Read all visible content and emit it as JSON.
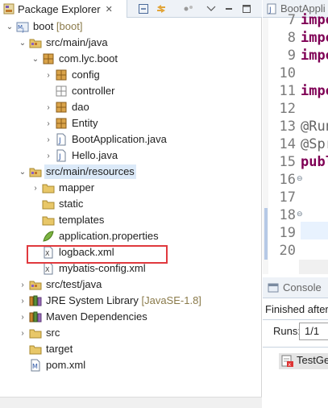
{
  "package_explorer": {
    "tab_title": "Package Explorer",
    "tab_close": "✕",
    "tree": [
      {
        "key": "boot",
        "label": "boot",
        "decoration": "[boot]",
        "icon": "maven-project-icon",
        "twisty": "open"
      },
      {
        "key": "src_main_java",
        "label": "src/main/java",
        "icon": "source-folder-icon",
        "twisty": "open"
      },
      {
        "key": "com_lyc_boot",
        "label": "com.lyc.boot",
        "icon": "package-icon",
        "twisty": "open"
      },
      {
        "key": "config",
        "label": "config",
        "icon": "package-icon",
        "twisty": "closed"
      },
      {
        "key": "controller",
        "label": "controller",
        "icon": "empty-package-icon",
        "twisty": "none"
      },
      {
        "key": "dao",
        "label": "dao",
        "icon": "package-icon",
        "twisty": "closed"
      },
      {
        "key": "entity",
        "label": "Entity",
        "icon": "package-icon",
        "twisty": "closed"
      },
      {
        "key": "bootapp",
        "label": "BootApplication.java",
        "icon": "java-file-icon",
        "twisty": "closed"
      },
      {
        "key": "hello",
        "label": "Hello.java",
        "icon": "java-file-icon",
        "twisty": "closed"
      },
      {
        "key": "src_main_resources",
        "label": "src/main/resources",
        "icon": "source-folder-icon",
        "twisty": "open",
        "selected": true
      },
      {
        "key": "mapper",
        "label": "mapper",
        "icon": "folder-icon",
        "twisty": "closed"
      },
      {
        "key": "static",
        "label": "static",
        "icon": "folder-icon",
        "twisty": "none"
      },
      {
        "key": "templates",
        "label": "templates",
        "icon": "folder-icon",
        "twisty": "none"
      },
      {
        "key": "app_props",
        "label": "application.properties",
        "icon": "properties-file-icon",
        "twisty": "none"
      },
      {
        "key": "logback",
        "label": "logback.xml",
        "icon": "xml-file-icon",
        "twisty": "none",
        "highlighted": true
      },
      {
        "key": "mybatis",
        "label": "mybatis-config.xml",
        "icon": "xml-file-icon",
        "twisty": "none"
      },
      {
        "key": "src_test_java",
        "label": "src/test/java",
        "icon": "source-folder-icon",
        "twisty": "closed"
      },
      {
        "key": "jre",
        "label": "JRE System Library",
        "decoration": "[JavaSE-1.8]",
        "icon": "library-icon",
        "twisty": "closed"
      },
      {
        "key": "maven_deps",
        "label": "Maven Dependencies",
        "icon": "library-icon",
        "twisty": "closed"
      },
      {
        "key": "src",
        "label": "src",
        "icon": "folder-icon",
        "twisty": "closed"
      },
      {
        "key": "target",
        "label": "target",
        "icon": "folder-icon",
        "twisty": "none"
      },
      {
        "key": "pom",
        "label": "pom.xml",
        "icon": "maven-pom-icon",
        "twisty": "none"
      }
    ]
  },
  "editor": {
    "tab_title": "BootAppli",
    "lines": [
      {
        "num": "7",
        "text": "impo",
        "style": "kw"
      },
      {
        "num": "8",
        "text": "impo",
        "style": "kw"
      },
      {
        "num": "9",
        "text": "impo",
        "style": "kw"
      },
      {
        "num": "10",
        "text": "",
        "style": ""
      },
      {
        "num": "11",
        "text": "impo",
        "style": "kw"
      },
      {
        "num": "12",
        "text": "",
        "style": ""
      },
      {
        "num": "13",
        "text": "@Run",
        "style": "ann"
      },
      {
        "num": "14",
        "text": "@Spr",
        "style": "ann"
      },
      {
        "num": "15",
        "text": "publ",
        "style": "kw"
      },
      {
        "num": "16",
        "text": "",
        "style": "",
        "fold": true
      },
      {
        "num": "17",
        "text": "",
        "style": ""
      },
      {
        "num": "18",
        "text": "",
        "style": "",
        "fold": true
      },
      {
        "num": "19",
        "text": "",
        "style": ""
      },
      {
        "num": "20",
        "text": "",
        "style": ""
      }
    ]
  },
  "console": {
    "tab_title": "Console",
    "status": "Finished after",
    "runs_label": "Runs:",
    "runs_value": "1/1",
    "test_label": "TestGe"
  }
}
